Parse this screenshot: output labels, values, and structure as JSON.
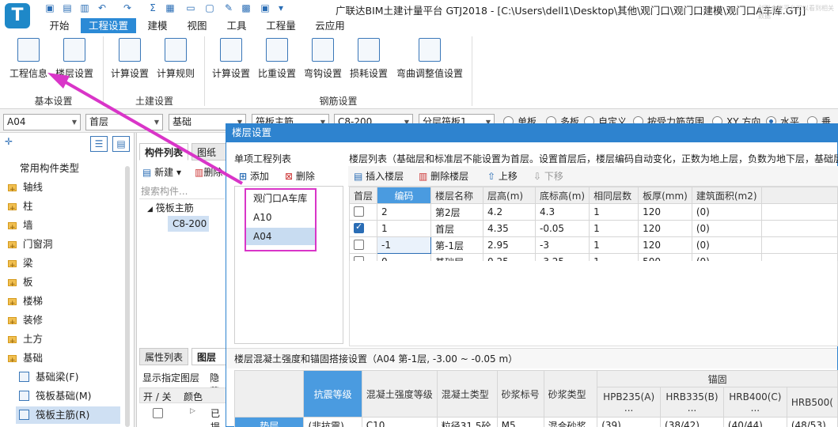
{
  "app": {
    "logo_letter": "T",
    "title": "广联达BIM土建计量平台 GTJ2018 - [C:\\Users\\dell1\\Desktop\\其他\\观门口\\观门口建模\\观门口A车库.GTJ]",
    "ghost_text": "创联合作平台可以看到相关数据",
    "quick_access": [
      "save-icon",
      "new-file-icon",
      "open-file-icon",
      "print-icon",
      "undo-icon",
      "redo-icon",
      "sum-icon",
      "image-icon",
      "file-icon",
      "document-icon",
      "ruler-icon",
      "grid-icon",
      "calc-icon",
      "dropdown-icon"
    ]
  },
  "menu": [
    "开始",
    "工程设置",
    "建模",
    "视图",
    "工具",
    "工程量",
    "云应用"
  ],
  "ribbon": {
    "buttons": [
      "工程信息",
      "楼层设置",
      "计算设置",
      "计算规则",
      "计算设置",
      "比重设置",
      "弯钩设置",
      "损耗设置",
      "弯曲调整值设置"
    ],
    "groups": [
      "基本设置",
      "土建设置",
      "钢筋设置"
    ]
  },
  "combos": [
    "A04",
    "首层",
    "基础",
    "筏板主筋",
    "C8-200",
    "分层筏板1"
  ],
  "radios": {
    "labels": [
      "单板",
      "多板",
      "自定义",
      "按受力筋范围",
      "XY 方向",
      "水平",
      "垂直"
    ],
    "selected": "水平"
  },
  "left": {
    "root": "常用构件类型",
    "items": [
      "轴线",
      "柱",
      "墙",
      "门窗洞",
      "梁",
      "板",
      "楼梯",
      "装修",
      "土方",
      "基础"
    ],
    "sub": [
      "基础梁(F)",
      "筏板基础(M)",
      "筏板主筋(R)"
    ]
  },
  "middle": {
    "tabs": [
      "构件列表",
      "图纸管"
    ],
    "new_btn": "新建",
    "delete_btn": "删除",
    "search_placeholder": "搜索构件...",
    "tree_parent": "筏板主筋",
    "tree_child": "C8-200",
    "bottom_tabs": [
      "属性列表",
      "图层管"
    ],
    "show_layer": "显示指定图层",
    "hide": "隐藏",
    "cols": [
      "开 / 关",
      "颜色"
    ],
    "row_text": "已提"
  },
  "dialog": {
    "title": "楼层设置",
    "project_list_label": "单项工程列表",
    "add": "添加",
    "delete": "删除",
    "projects": [
      "观门口A车库",
      "A10",
      "A04"
    ],
    "selected_project": "A04",
    "floor_hint": "楼层列表（基础层和标准层不能设置为首层。设置首层后，楼层编码自动变化，正数为地上层，负数为地下层，基础层",
    "insert_floor": "插入楼层",
    "delete_floor": "删除楼层",
    "move_up": "上移",
    "move_down": "下移",
    "columns": [
      "首层",
      "编码",
      "楼层名称",
      "层高(m)",
      "底标高(m)",
      "相同层数",
      "板厚(mm)",
      "建筑面积(m2)"
    ],
    "rows": [
      {
        "first": false,
        "code": "2",
        "name": "第2层",
        "h": "4.2",
        "bottom": "4.3",
        "same": "1",
        "thick": "120",
        "area": "(0)"
      },
      {
        "first": true,
        "code": "1",
        "name": "首层",
        "h": "4.35",
        "bottom": "-0.05",
        "same": "1",
        "thick": "120",
        "area": "(0)"
      },
      {
        "first": false,
        "code": "-1",
        "name": "第-1层",
        "h": "2.95",
        "bottom": "-3",
        "same": "1",
        "thick": "120",
        "area": "(0)"
      },
      {
        "first": false,
        "code": "0",
        "name": "基础层",
        "h": "0.25",
        "bottom": "-3.25",
        "same": "1",
        "thick": "500",
        "area": "(0)"
      }
    ],
    "concrete_label": "楼层混凝土强度和锚固搭接设置（A04  第-1层, -3.00 ~ -0.05 m）",
    "anchor_header": "锚固",
    "concrete_cols": [
      "抗震等级",
      "混凝土强度等级",
      "混凝土类型",
      "砂浆标号",
      "砂浆类型",
      "HPB235(A)\n...",
      "HRB335(B)\n...",
      "HRB400(C)\n...",
      "HRB500("
    ],
    "concrete_row": [
      "垫层",
      "(非抗震)",
      "C10",
      "粒径31.5砼",
      "M5",
      "混合砂浆",
      "(39)",
      "(38/42)",
      "(40/44)",
      "(48/53)"
    ]
  },
  "colors": {
    "accent": "#2e83cf",
    "annotation": "#d935c8"
  }
}
